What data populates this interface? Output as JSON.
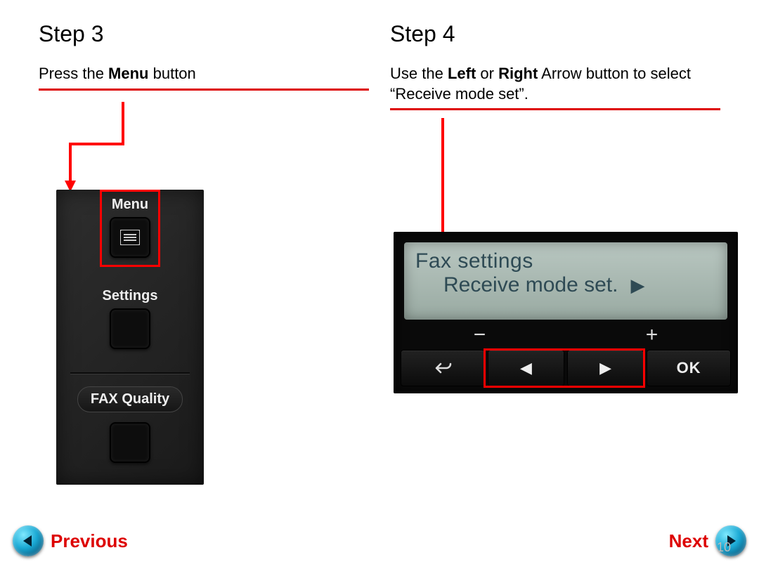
{
  "steps": {
    "left": {
      "title": "Step 3",
      "instruction_pre": "Press the ",
      "instruction_bold": "Menu",
      "instruction_post": " button"
    },
    "right": {
      "title": "Step 4",
      "instruction_pre": "Use the ",
      "instruction_bold1": "Left",
      "instruction_mid": " or ",
      "instruction_bold2": "Right",
      "instruction_post": " Arrow button to select “Receive mode set”."
    }
  },
  "printer_panel": {
    "menu_label": "Menu",
    "settings_label": "Settings",
    "fax_label": "FAX Quality"
  },
  "lcd": {
    "line1": "Fax settings",
    "line2": "Receive mode set.",
    "arrow_glyph": "▶"
  },
  "keys": {
    "minus": "−",
    "plus": "+",
    "back_icon": "back-icon",
    "left_glyph": "◀",
    "right_glyph": "▶",
    "ok": "OK"
  },
  "footer": {
    "prev": "Previous",
    "next": "Next",
    "page": "10"
  },
  "colors": {
    "accent_red": "#d00000",
    "highlight_red": "#ff0000"
  }
}
